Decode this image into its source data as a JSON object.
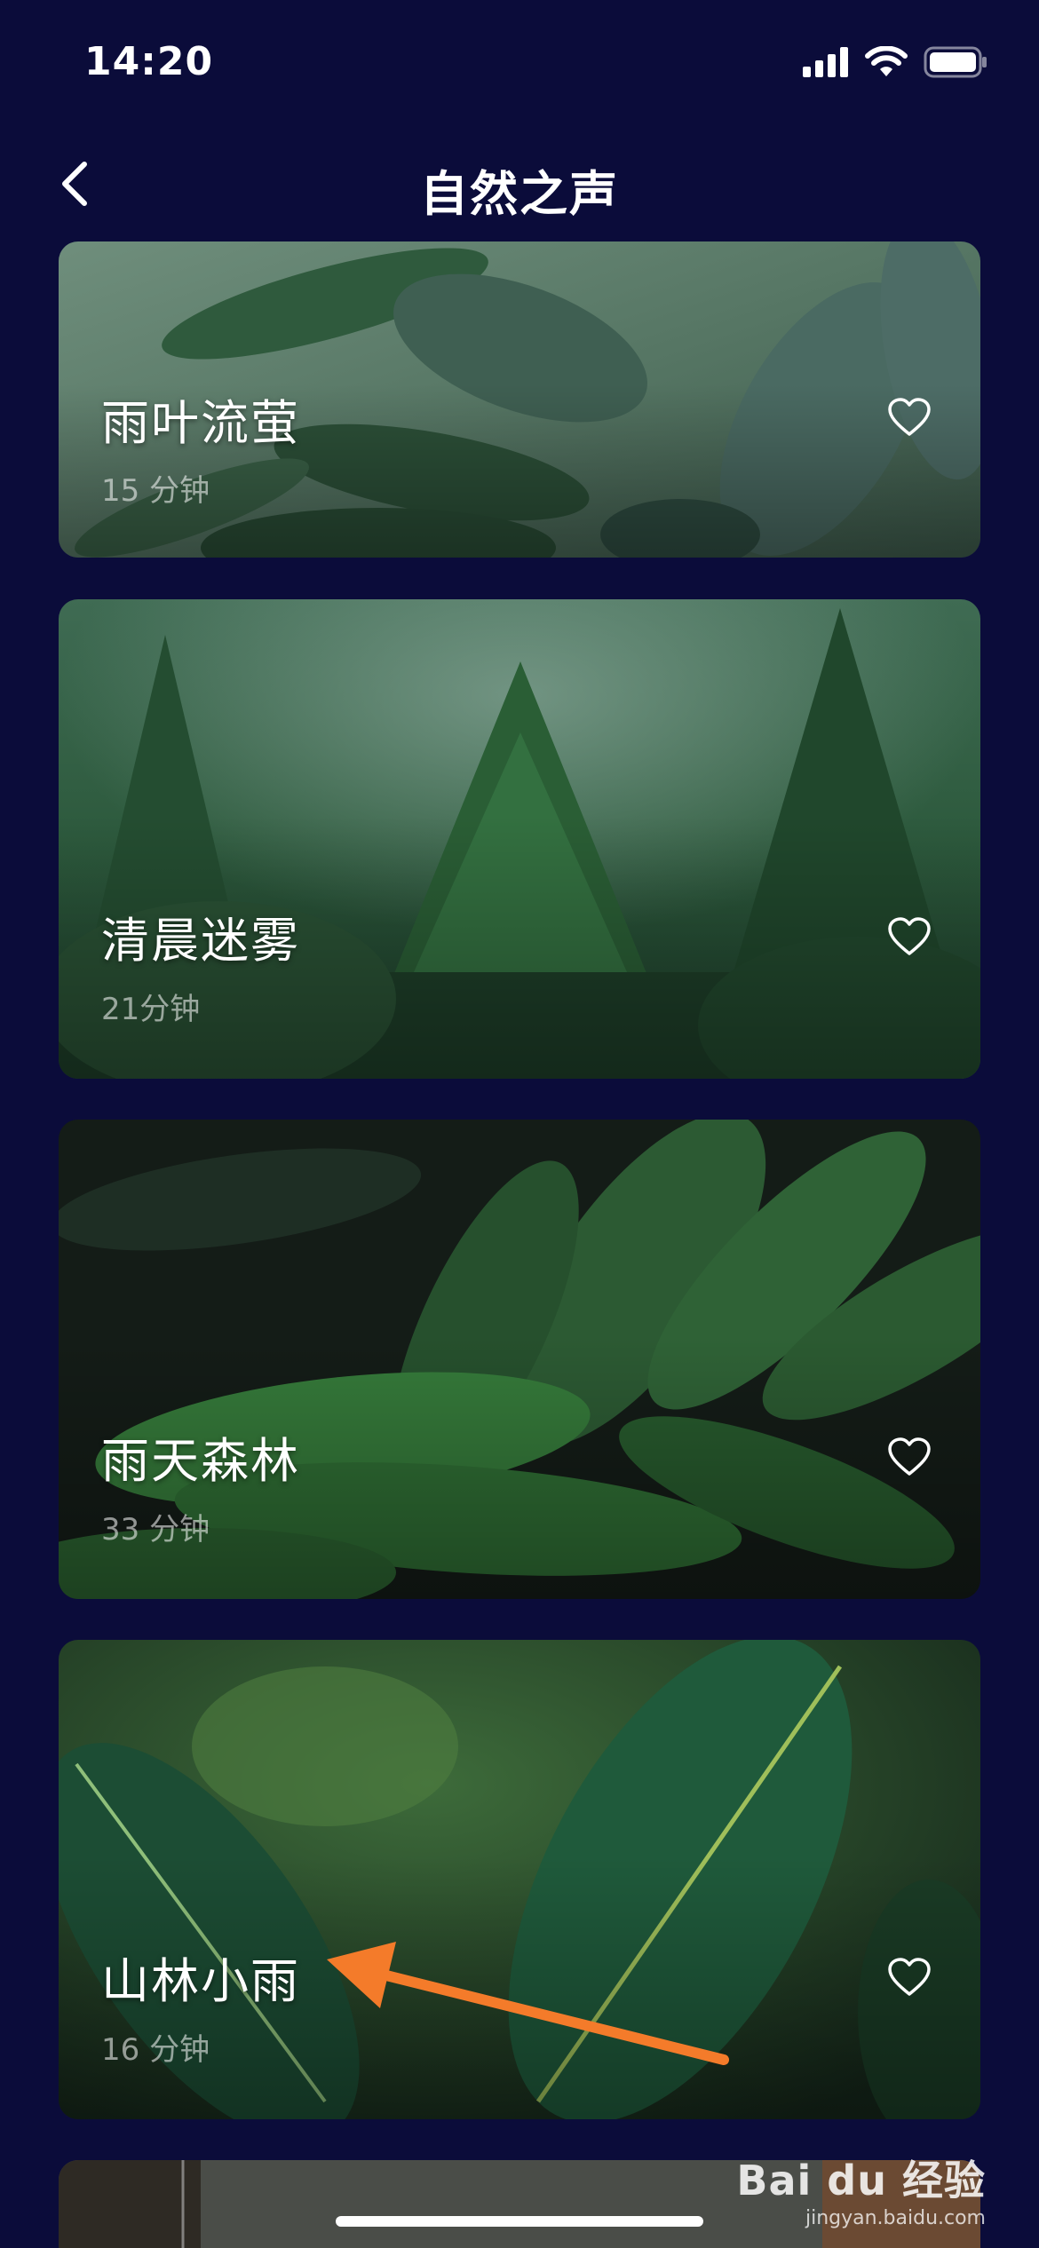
{
  "status_bar": {
    "time": "14:20"
  },
  "header": {
    "title": "自然之声"
  },
  "cards": [
    {
      "title": "雨叶流萤",
      "duration": "15 分钟",
      "icon": "heart-outline-icon"
    },
    {
      "title": "清晨迷雾",
      "duration": "21分钟",
      "icon": "heart-outline-icon"
    },
    {
      "title": "雨天森林",
      "duration": "33 分钟",
      "icon": "heart-outline-icon"
    },
    {
      "title": "山林小雨",
      "duration": "16 分钟",
      "icon": "heart-outline-icon"
    }
  ],
  "annotation": {
    "color": "#f47b2a"
  },
  "watermark": {
    "brand": "Bai du 经验",
    "site": "jingyan.baidu.com"
  },
  "colors": {
    "background": "#0b0c3a",
    "text": "#ffffff"
  }
}
